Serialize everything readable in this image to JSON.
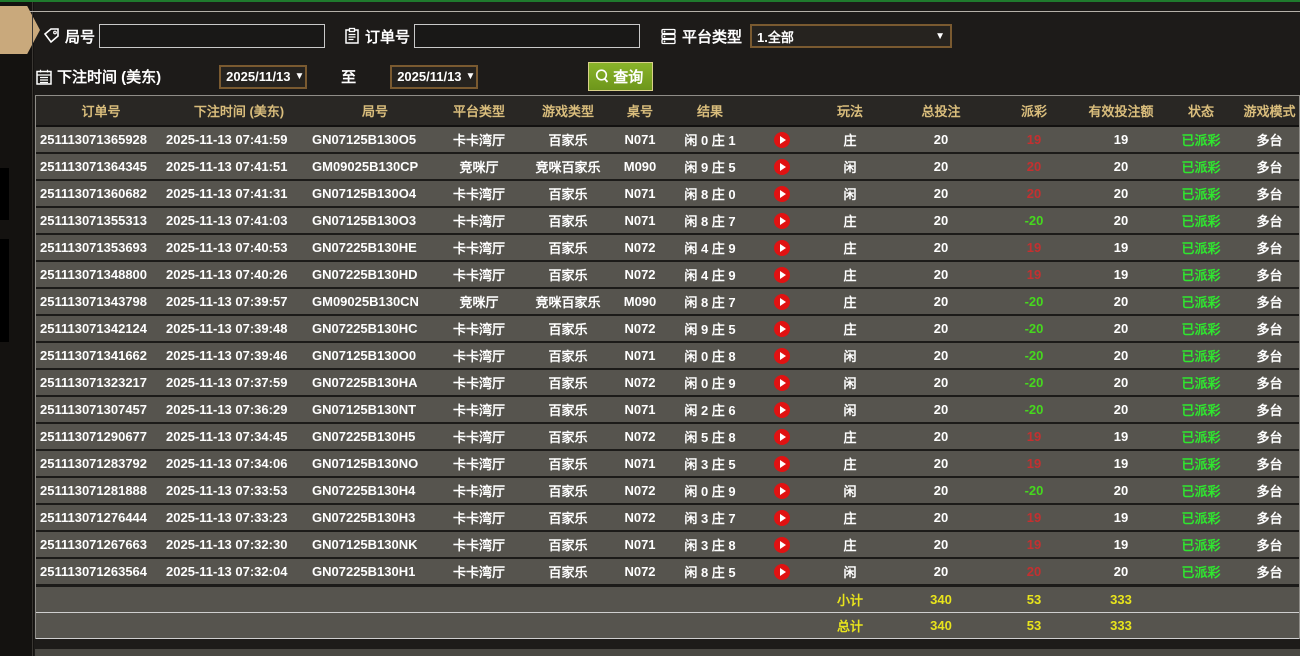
{
  "filters": {
    "round_label": "局号",
    "round_value": "",
    "order_label": "订单号",
    "order_value": "",
    "platform_label": "平台类型",
    "platform_value": "1.全部",
    "bet_time_label": "下注时间 (美东)",
    "date_from": "2025/11/13",
    "date_to": "2025/11/13",
    "to_label": "至",
    "search_label": "查询",
    "caret": "▼"
  },
  "table": {
    "headers": {
      "order": "订单号",
      "time": "下注时间 (美东)",
      "round": "局号",
      "platform": "平台类型",
      "game": "游戏类型",
      "table_no": "桌号",
      "result": "结果",
      "play": "",
      "playtype": "玩法",
      "bet": "总投注",
      "payout": "派彩",
      "valid": "有效投注额",
      "status": "状态",
      "mode": "游戏模式"
    },
    "rows": [
      {
        "order": "251113071365928",
        "time": "2025-11-13 07:41:59",
        "round": "GN07125B130O5",
        "platform": "卡卡湾厅",
        "game": "百家乐",
        "table_no": "N071",
        "result": "闲 0 庄 1",
        "playtype": "庄",
        "bet": "20",
        "payout": "19",
        "valid": "19",
        "status": "已派彩",
        "mode": "多台"
      },
      {
        "order": "251113071364345",
        "time": "2025-11-13 07:41:51",
        "round": "GM09025B130CP",
        "platform": "竞咪厅",
        "game": "竞咪百家乐",
        "table_no": "M090",
        "result": "闲 9 庄 5",
        "playtype": "闲",
        "bet": "20",
        "payout": "20",
        "valid": "20",
        "status": "已派彩",
        "mode": "多台"
      },
      {
        "order": "251113071360682",
        "time": "2025-11-13 07:41:31",
        "round": "GN07125B130O4",
        "platform": "卡卡湾厅",
        "game": "百家乐",
        "table_no": "N071",
        "result": "闲 8 庄 0",
        "playtype": "闲",
        "bet": "20",
        "payout": "20",
        "valid": "20",
        "status": "已派彩",
        "mode": "多台"
      },
      {
        "order": "251113071355313",
        "time": "2025-11-13 07:41:03",
        "round": "GN07125B130O3",
        "platform": "卡卡湾厅",
        "game": "百家乐",
        "table_no": "N071",
        "result": "闲 8 庄 7",
        "playtype": "庄",
        "bet": "20",
        "payout": "-20",
        "valid": "20",
        "status": "已派彩",
        "mode": "多台"
      },
      {
        "order": "251113071353693",
        "time": "2025-11-13 07:40:53",
        "round": "GN07225B130HE",
        "platform": "卡卡湾厅",
        "game": "百家乐",
        "table_no": "N072",
        "result": "闲 4 庄 9",
        "playtype": "庄",
        "bet": "20",
        "payout": "19",
        "valid": "19",
        "status": "已派彩",
        "mode": "多台"
      },
      {
        "order": "251113071348800",
        "time": "2025-11-13 07:40:26",
        "round": "GN07225B130HD",
        "platform": "卡卡湾厅",
        "game": "百家乐",
        "table_no": "N072",
        "result": "闲 4 庄 9",
        "playtype": "庄",
        "bet": "20",
        "payout": "19",
        "valid": "19",
        "status": "已派彩",
        "mode": "多台"
      },
      {
        "order": "251113071343798",
        "time": "2025-11-13 07:39:57",
        "round": "GM09025B130CN",
        "platform": "竞咪厅",
        "game": "竞咪百家乐",
        "table_no": "M090",
        "result": "闲 8 庄 7",
        "playtype": "庄",
        "bet": "20",
        "payout": "-20",
        "valid": "20",
        "status": "已派彩",
        "mode": "多台"
      },
      {
        "order": "251113071342124",
        "time": "2025-11-13 07:39:48",
        "round": "GN07225B130HC",
        "platform": "卡卡湾厅",
        "game": "百家乐",
        "table_no": "N072",
        "result": "闲 9 庄 5",
        "playtype": "庄",
        "bet": "20",
        "payout": "-20",
        "valid": "20",
        "status": "已派彩",
        "mode": "多台"
      },
      {
        "order": "251113071341662",
        "time": "2025-11-13 07:39:46",
        "round": "GN07125B130O0",
        "platform": "卡卡湾厅",
        "game": "百家乐",
        "table_no": "N071",
        "result": "闲 0 庄 8",
        "playtype": "闲",
        "bet": "20",
        "payout": "-20",
        "valid": "20",
        "status": "已派彩",
        "mode": "多台"
      },
      {
        "order": "251113071323217",
        "time": "2025-11-13 07:37:59",
        "round": "GN07225B130HA",
        "platform": "卡卡湾厅",
        "game": "百家乐",
        "table_no": "N072",
        "result": "闲 0 庄 9",
        "playtype": "闲",
        "bet": "20",
        "payout": "-20",
        "valid": "20",
        "status": "已派彩",
        "mode": "多台"
      },
      {
        "order": "251113071307457",
        "time": "2025-11-13 07:36:29",
        "round": "GN07125B130NT",
        "platform": "卡卡湾厅",
        "game": "百家乐",
        "table_no": "N071",
        "result": "闲 2 庄 6",
        "playtype": "闲",
        "bet": "20",
        "payout": "-20",
        "valid": "20",
        "status": "已派彩",
        "mode": "多台"
      },
      {
        "order": "251113071290677",
        "time": "2025-11-13 07:34:45",
        "round": "GN07225B130H5",
        "platform": "卡卡湾厅",
        "game": "百家乐",
        "table_no": "N072",
        "result": "闲 5 庄 8",
        "playtype": "庄",
        "bet": "20",
        "payout": "19",
        "valid": "19",
        "status": "已派彩",
        "mode": "多台"
      },
      {
        "order": "251113071283792",
        "time": "2025-11-13 07:34:06",
        "round": "GN07125B130NO",
        "platform": "卡卡湾厅",
        "game": "百家乐",
        "table_no": "N071",
        "result": "闲 3 庄 5",
        "playtype": "庄",
        "bet": "20",
        "payout": "19",
        "valid": "19",
        "status": "已派彩",
        "mode": "多台"
      },
      {
        "order": "251113071281888",
        "time": "2025-11-13 07:33:53",
        "round": "GN07225B130H4",
        "platform": "卡卡湾厅",
        "game": "百家乐",
        "table_no": "N072",
        "result": "闲 0 庄 9",
        "playtype": "闲",
        "bet": "20",
        "payout": "-20",
        "valid": "20",
        "status": "已派彩",
        "mode": "多台"
      },
      {
        "order": "251113071276444",
        "time": "2025-11-13 07:33:23",
        "round": "GN07225B130H3",
        "platform": "卡卡湾厅",
        "game": "百家乐",
        "table_no": "N072",
        "result": "闲 3 庄 7",
        "playtype": "庄",
        "bet": "20",
        "payout": "19",
        "valid": "19",
        "status": "已派彩",
        "mode": "多台"
      },
      {
        "order": "251113071267663",
        "time": "2025-11-13 07:32:30",
        "round": "GN07125B130NK",
        "platform": "卡卡湾厅",
        "game": "百家乐",
        "table_no": "N071",
        "result": "闲 3 庄 8",
        "playtype": "庄",
        "bet": "20",
        "payout": "19",
        "valid": "19",
        "status": "已派彩",
        "mode": "多台"
      },
      {
        "order": "251113071263564",
        "time": "2025-11-13 07:32:04",
        "round": "GN07225B130H1",
        "platform": "卡卡湾厅",
        "game": "百家乐",
        "table_no": "N072",
        "result": "闲 8 庄 5",
        "playtype": "闲",
        "bet": "20",
        "payout": "20",
        "valid": "20",
        "status": "已派彩",
        "mode": "多台"
      }
    ],
    "subtotal": {
      "label": "小计",
      "bet": "340",
      "payout": "53",
      "valid": "333"
    },
    "total": {
      "label": "总计",
      "bet": "340",
      "payout": "53",
      "valid": "333"
    }
  },
  "colors": {
    "header_text": "#d9bd7c",
    "row_bg": "#56544e",
    "payout_win": "#c43030",
    "payout_loss": "#46d81e",
    "status_green": "#2fe62f",
    "totals_yellow": "#e8e41c",
    "search_btn_green": "#7aa322",
    "play_btn_red": "#e01212",
    "date_border_brown": "#7a5a30",
    "tan_tab": "#c9a97c"
  }
}
